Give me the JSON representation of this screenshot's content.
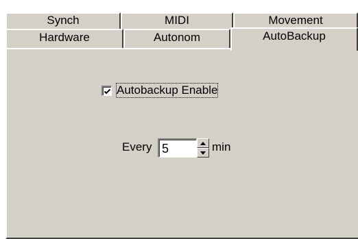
{
  "tabs": {
    "row1": [
      "Synch",
      "MIDI",
      "Movement"
    ],
    "row2": [
      "Hardware",
      "Autonom",
      "AutoBackup"
    ],
    "active": "AutoBackup"
  },
  "autobackup": {
    "enable_label": "Autobackup Enable",
    "enabled": true,
    "every_label": "Every",
    "interval_value": "5",
    "unit_label": "min"
  },
  "icons": {
    "checkmark": "check-icon",
    "spin_up": "arrow-up-icon",
    "spin_down": "arrow-down-icon"
  }
}
